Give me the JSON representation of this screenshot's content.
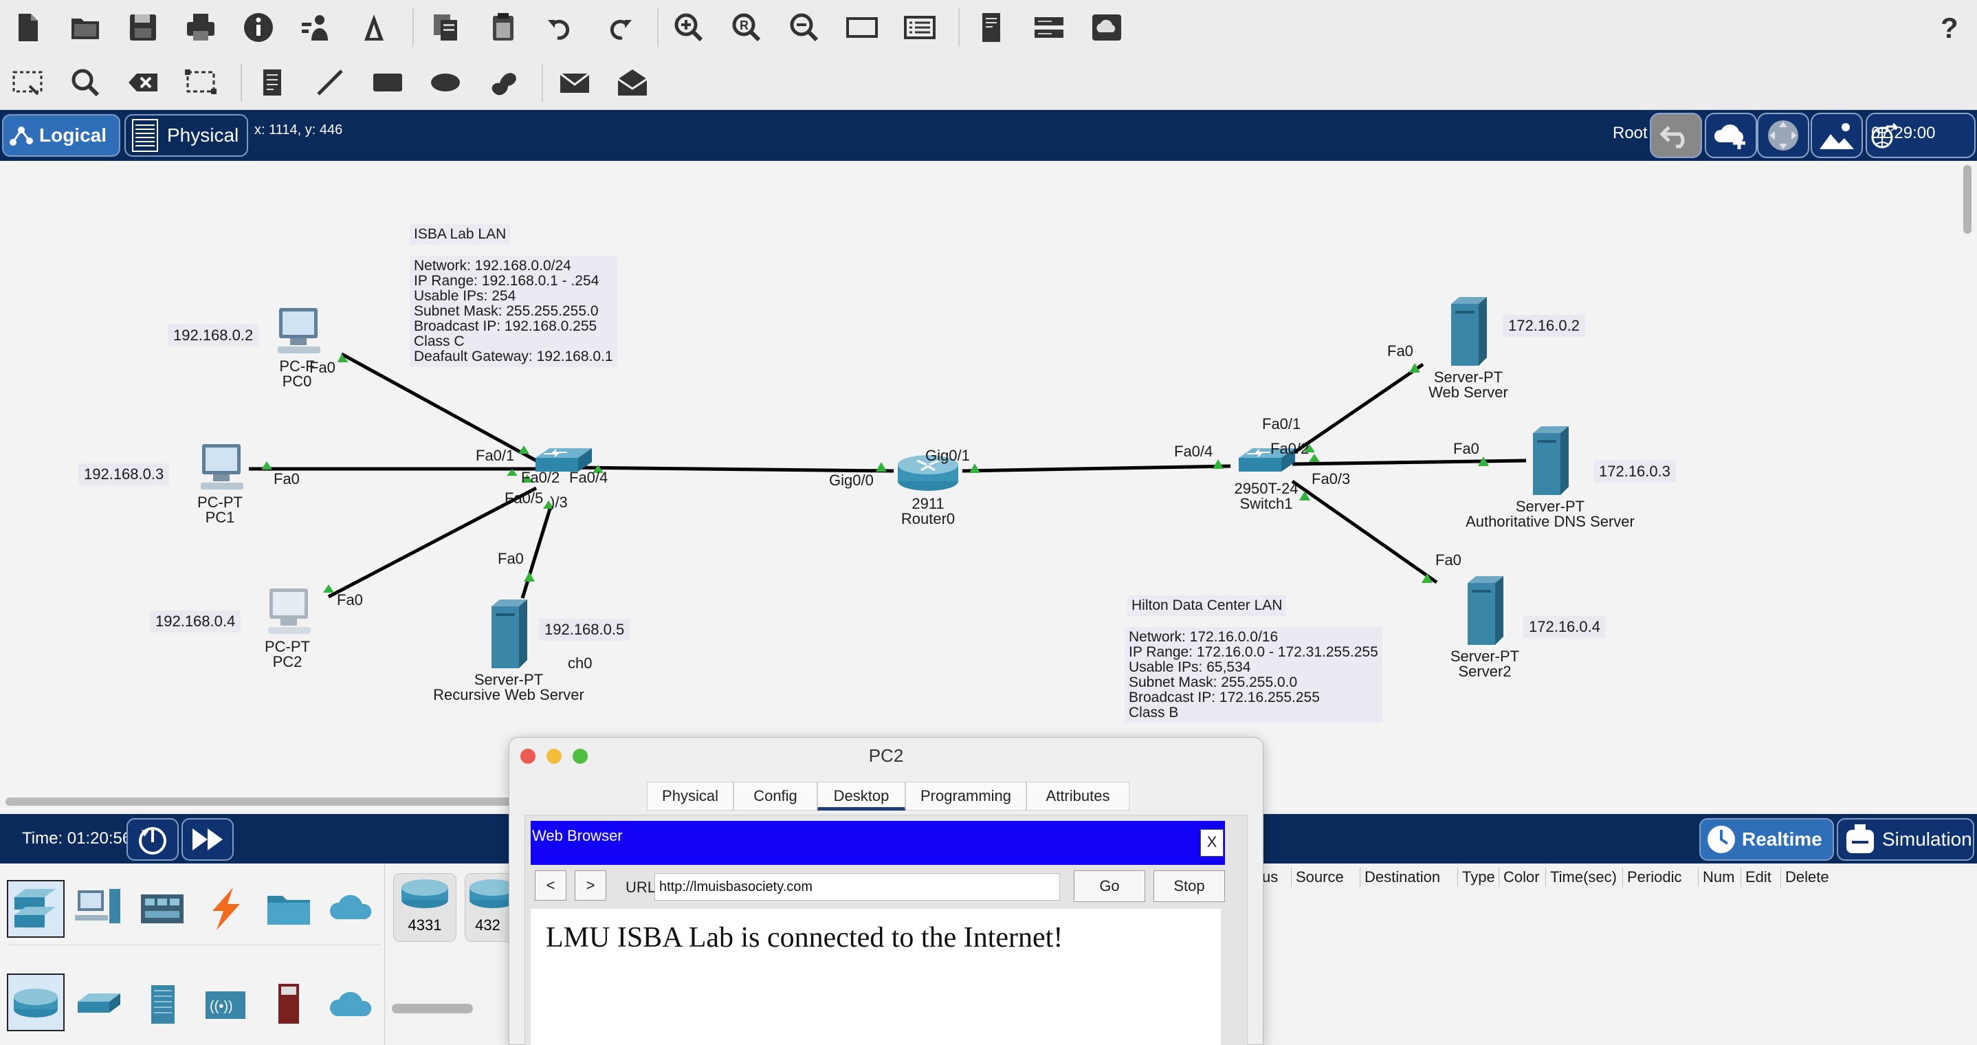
{
  "toolbar1": {
    "icons": [
      "new-file",
      "open-folder",
      "save",
      "print",
      "info",
      "activity-wizard",
      "custom-device",
      "copy",
      "paste",
      "undo",
      "redo",
      "zoom-in",
      "zoom-reset",
      "zoom-out",
      "palette",
      "viewport",
      "cluster",
      "device-template",
      "cloud-manager"
    ],
    "help": "?"
  },
  "toolbar2": {
    "icons": [
      "select",
      "inspect",
      "delete",
      "resize-shape",
      "note",
      "line",
      "rectangle",
      "ellipse",
      "freeform",
      "simple-pdu",
      "complex-pdu"
    ]
  },
  "nav": {
    "logical": "Logical",
    "physical": "Physical",
    "coords": "x: 1114, y: 446",
    "root": "Root",
    "clock": "07:29:00"
  },
  "network": {
    "lan1_title": "ISBA Lab LAN",
    "lan1_info": [
      "Network: 192.168.0.0/24",
      "IP Range: 192.168.0.1 - .254",
      "Usable IPs: 254",
      "Subnet Mask: 255.255.255.0",
      "Broadcast IP: 192.168.0.255",
      "Class C",
      "Deafault Gateway: 192.168.0.1"
    ],
    "lan2_title": "Hilton Data Center LAN",
    "lan2_info": [
      "Network: 172.16.0.0/16",
      "IP Range: 172.16.0.0 - 172.31.255.255",
      "Usable IPs: 65,534",
      "Subnet Mask: 255.255.0.0",
      "Broadcast IP: 172.16.255.255",
      "Class B"
    ],
    "ips": {
      "pc0": "192.168.0.2",
      "pc1": "192.168.0.3",
      "pc2": "192.168.0.4",
      "rws": "192.168.0.5",
      "web": "172.16.0.2",
      "dns": "172.16.0.3",
      "s2": "172.16.0.4"
    },
    "devices": {
      "pc0": {
        "type": "PC-F",
        "name": "PC0"
      },
      "pc1": {
        "type": "PC-PT",
        "name": "PC1"
      },
      "pc2": {
        "type": "PC-PT",
        "name": "PC2"
      },
      "rws": {
        "type": "Server-PT",
        "name": "Recursive Web Server"
      },
      "router": {
        "type": "2911",
        "name": "Router0"
      },
      "switch0": {
        "name": "ch0"
      },
      "switch1": {
        "type": "2950T-24",
        "name": "Switch1"
      },
      "web": {
        "type": "Server-PT",
        "name": "Web Server"
      },
      "dns": {
        "type": "Server-PT",
        "name": "Authoritative DNS Server"
      },
      "s2": {
        "type": "Server-PT",
        "name": "Server2"
      }
    },
    "ports": {
      "pc0_fa0": "Fa0",
      "pc1_fa0": "Fa0",
      "pc2_fa0": "Fa0",
      "rws_fa0": "Fa0",
      "sw0_fa01": "Fa0/1",
      "sw0_fa02": "Fa0/2",
      "sw0_fa04": "Fa0/4",
      "sw0_fa05": "Fa0/5",
      "sw0_fa03": ")/3",
      "r_gig00": "Gig0/0",
      "r_gig01": "Gig0/1",
      "sw1_fa04": "Fa0/4",
      "sw1_fa01": "Fa0/1",
      "sw1_fa02": "Fa0/2",
      "sw1_fa03": "Fa0/3",
      "web_fa0": "Fa0",
      "dns_fa0": "Fa0",
      "s2_fa0": "Fa0"
    }
  },
  "bottom": {
    "time": "Time: 01:20:56",
    "realtime": "Realtime",
    "simulation": "Simulation",
    "models": [
      "4331",
      "432"
    ],
    "pdu_headers": [
      "us",
      "Source",
      "Destination",
      "Type",
      "Color",
      "Time(sec)",
      "Periodic",
      "Num",
      "Edit",
      "Delete"
    ]
  },
  "pc_window": {
    "title": "PC2",
    "tabs": [
      "Physical",
      "Config",
      "Desktop",
      "Programming",
      "Attributes"
    ],
    "active_tab": "Desktop",
    "browser_title": "Web Browser",
    "close": "X",
    "back": "<",
    "forward": ">",
    "url_label": "URL",
    "url_value": "http://lmuisbasociety.com",
    "go": "Go",
    "stop": "Stop",
    "page_text": "LMU ISBA Lab is connected to the Internet!"
  },
  "colors": {
    "nav_bg": "#0b2a5c",
    "active_btn": "#2f6fb9",
    "browser_bar": "#1000f5",
    "link_dot": "#33b33b"
  }
}
